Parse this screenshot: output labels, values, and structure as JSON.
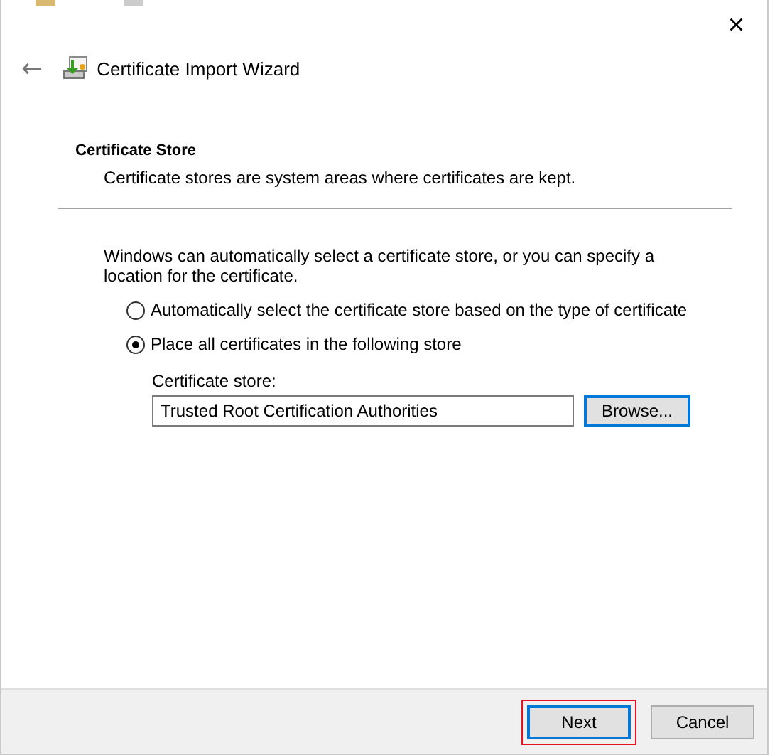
{
  "window": {
    "title": "Certificate Import Wizard",
    "close_label": "×",
    "back_label": "←"
  },
  "section": {
    "heading": "Certificate Store",
    "description": "Certificate stores are system areas where certificates are kept."
  },
  "intro": "Windows can automatically select a certificate store, or you can specify a location for the certificate.",
  "options": [
    {
      "label": "Automatically select the certificate store based on the type of certificate",
      "selected": false
    },
    {
      "label": "Place all certificates in the following store",
      "selected": true
    }
  ],
  "store": {
    "label": "Certificate store:",
    "value": "Trusted Root Certification Authorities",
    "browse": "Browse..."
  },
  "buttons": [
    {
      "label": "Next",
      "default": true,
      "highlighted": true
    },
    {
      "label": "Cancel",
      "default": false,
      "highlighted": false
    }
  ]
}
